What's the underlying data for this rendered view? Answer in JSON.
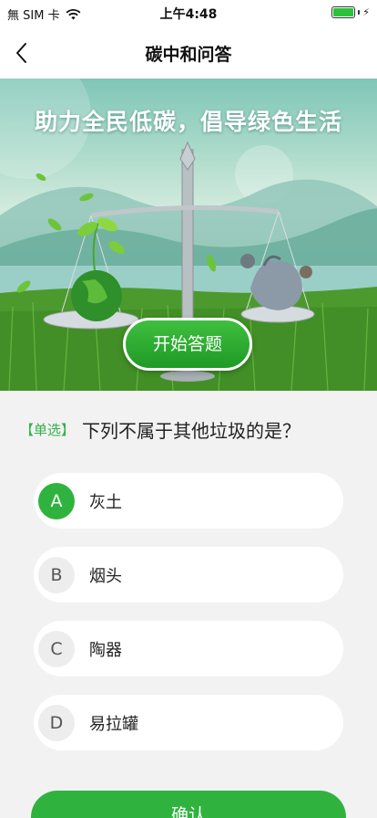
{
  "status_bar": {
    "carrier": "無 SIM 卡",
    "time": "上午4:48",
    "wifi_icon": "wifi-icon",
    "battery_icon": "battery-icon",
    "battery_level": 1.0
  },
  "nav": {
    "title": "碳中和问答",
    "back_icon": "chevron-left-icon"
  },
  "banner": {
    "slogan": "助力全民低碳，倡导绿色生活",
    "start_label": "开始答题"
  },
  "question": {
    "tag": "【单选】",
    "text": "下列不属于其他垃圾的是？"
  },
  "options": [
    {
      "letter": "A",
      "label": "灰土",
      "selected": true
    },
    {
      "letter": "B",
      "label": "烟头",
      "selected": false
    },
    {
      "letter": "C",
      "label": "陶器",
      "selected": false
    },
    {
      "letter": "D",
      "label": "易拉罐",
      "selected": false
    }
  ],
  "confirm_label": "确认",
  "colors": {
    "accent": "#2fb33e",
    "tag": "#31b24a",
    "background": "#f2f2f2"
  }
}
